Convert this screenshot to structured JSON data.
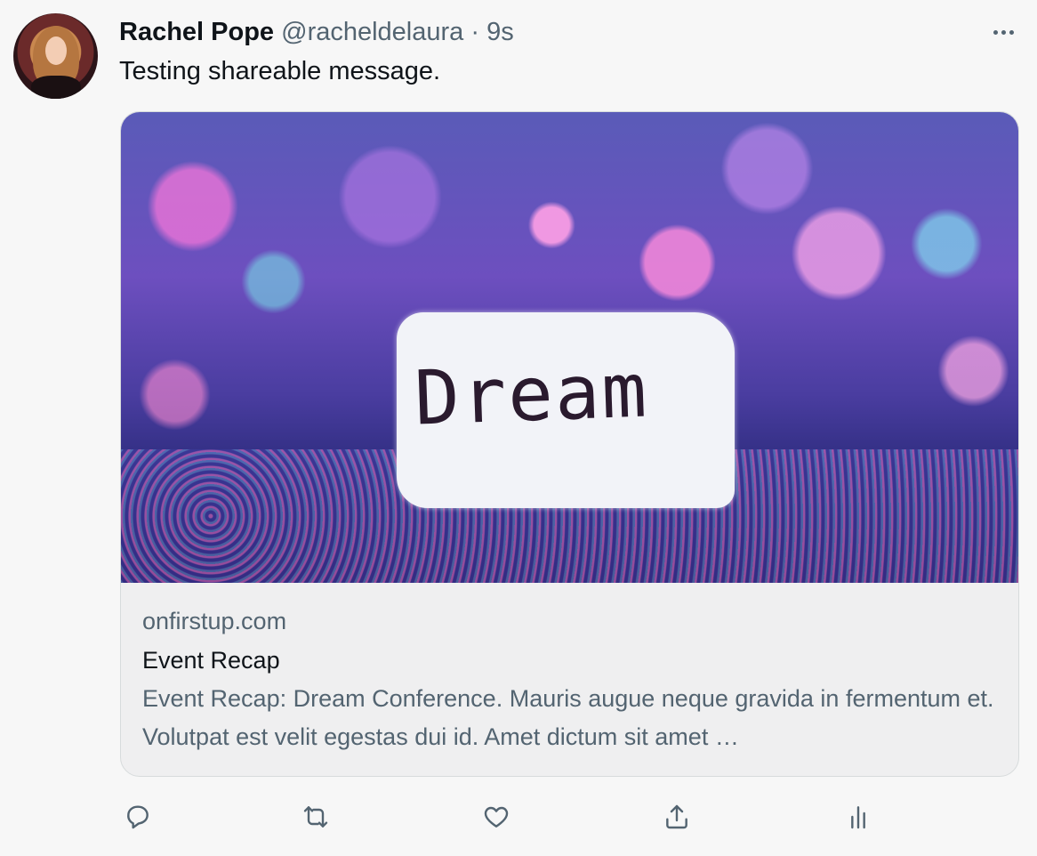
{
  "author": {
    "name": "Rachel Pope",
    "handle": "@racheldelaura",
    "separator": "·",
    "time": "9s"
  },
  "tweet_text": "Testing shareable message.",
  "card": {
    "image_text": "Dream",
    "domain": "onfirstup.com",
    "title": "Event Recap",
    "description": "Event Recap: Dream Conference. Mauris augue neque gravida in fermentum et. Volutpat est velit egestas dui id. Amet dictum sit amet …"
  },
  "actions": [
    {
      "icon": "reply-icon"
    },
    {
      "icon": "retweet-icon"
    },
    {
      "icon": "like-icon"
    },
    {
      "icon": "share-icon"
    },
    {
      "icon": "analytics-icon"
    }
  ],
  "colors": {
    "text_primary": "#0f1419",
    "text_secondary": "#536471",
    "card_border": "#d7dbdc",
    "background": "#f7f7f7"
  }
}
